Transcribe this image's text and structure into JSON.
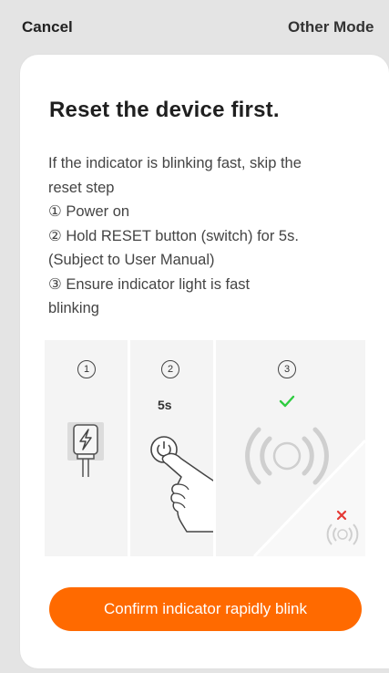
{
  "header": {
    "cancel_label": "Cancel",
    "other_mode_label": "Other Mode"
  },
  "card": {
    "title": "Reset the device first.",
    "description_lines": [
      "If the indicator is blinking fast, skip the",
      "reset step",
      "① Power on",
      "② Hold RESET button (switch) for 5s.",
      "(Subject to User Manual)",
      "③ Ensure indicator light is fast",
      "blinking"
    ],
    "steps": [
      {
        "number": "1",
        "icon": "power-plug-icon"
      },
      {
        "number": "2",
        "duration": "5s",
        "icon": "press-reset-button-icon"
      },
      {
        "number": "3",
        "icon": "blinking-indicator-icon",
        "status_icon": "check-icon",
        "wrong_icon": "cross-icon"
      }
    ],
    "confirm_button_label": "Confirm indicator rapidly blink"
  },
  "colors": {
    "accent": "#ff6a00",
    "check": "#2ecc40",
    "cross": "#e53935",
    "background": "#e4e4e4",
    "card": "#ffffff"
  }
}
